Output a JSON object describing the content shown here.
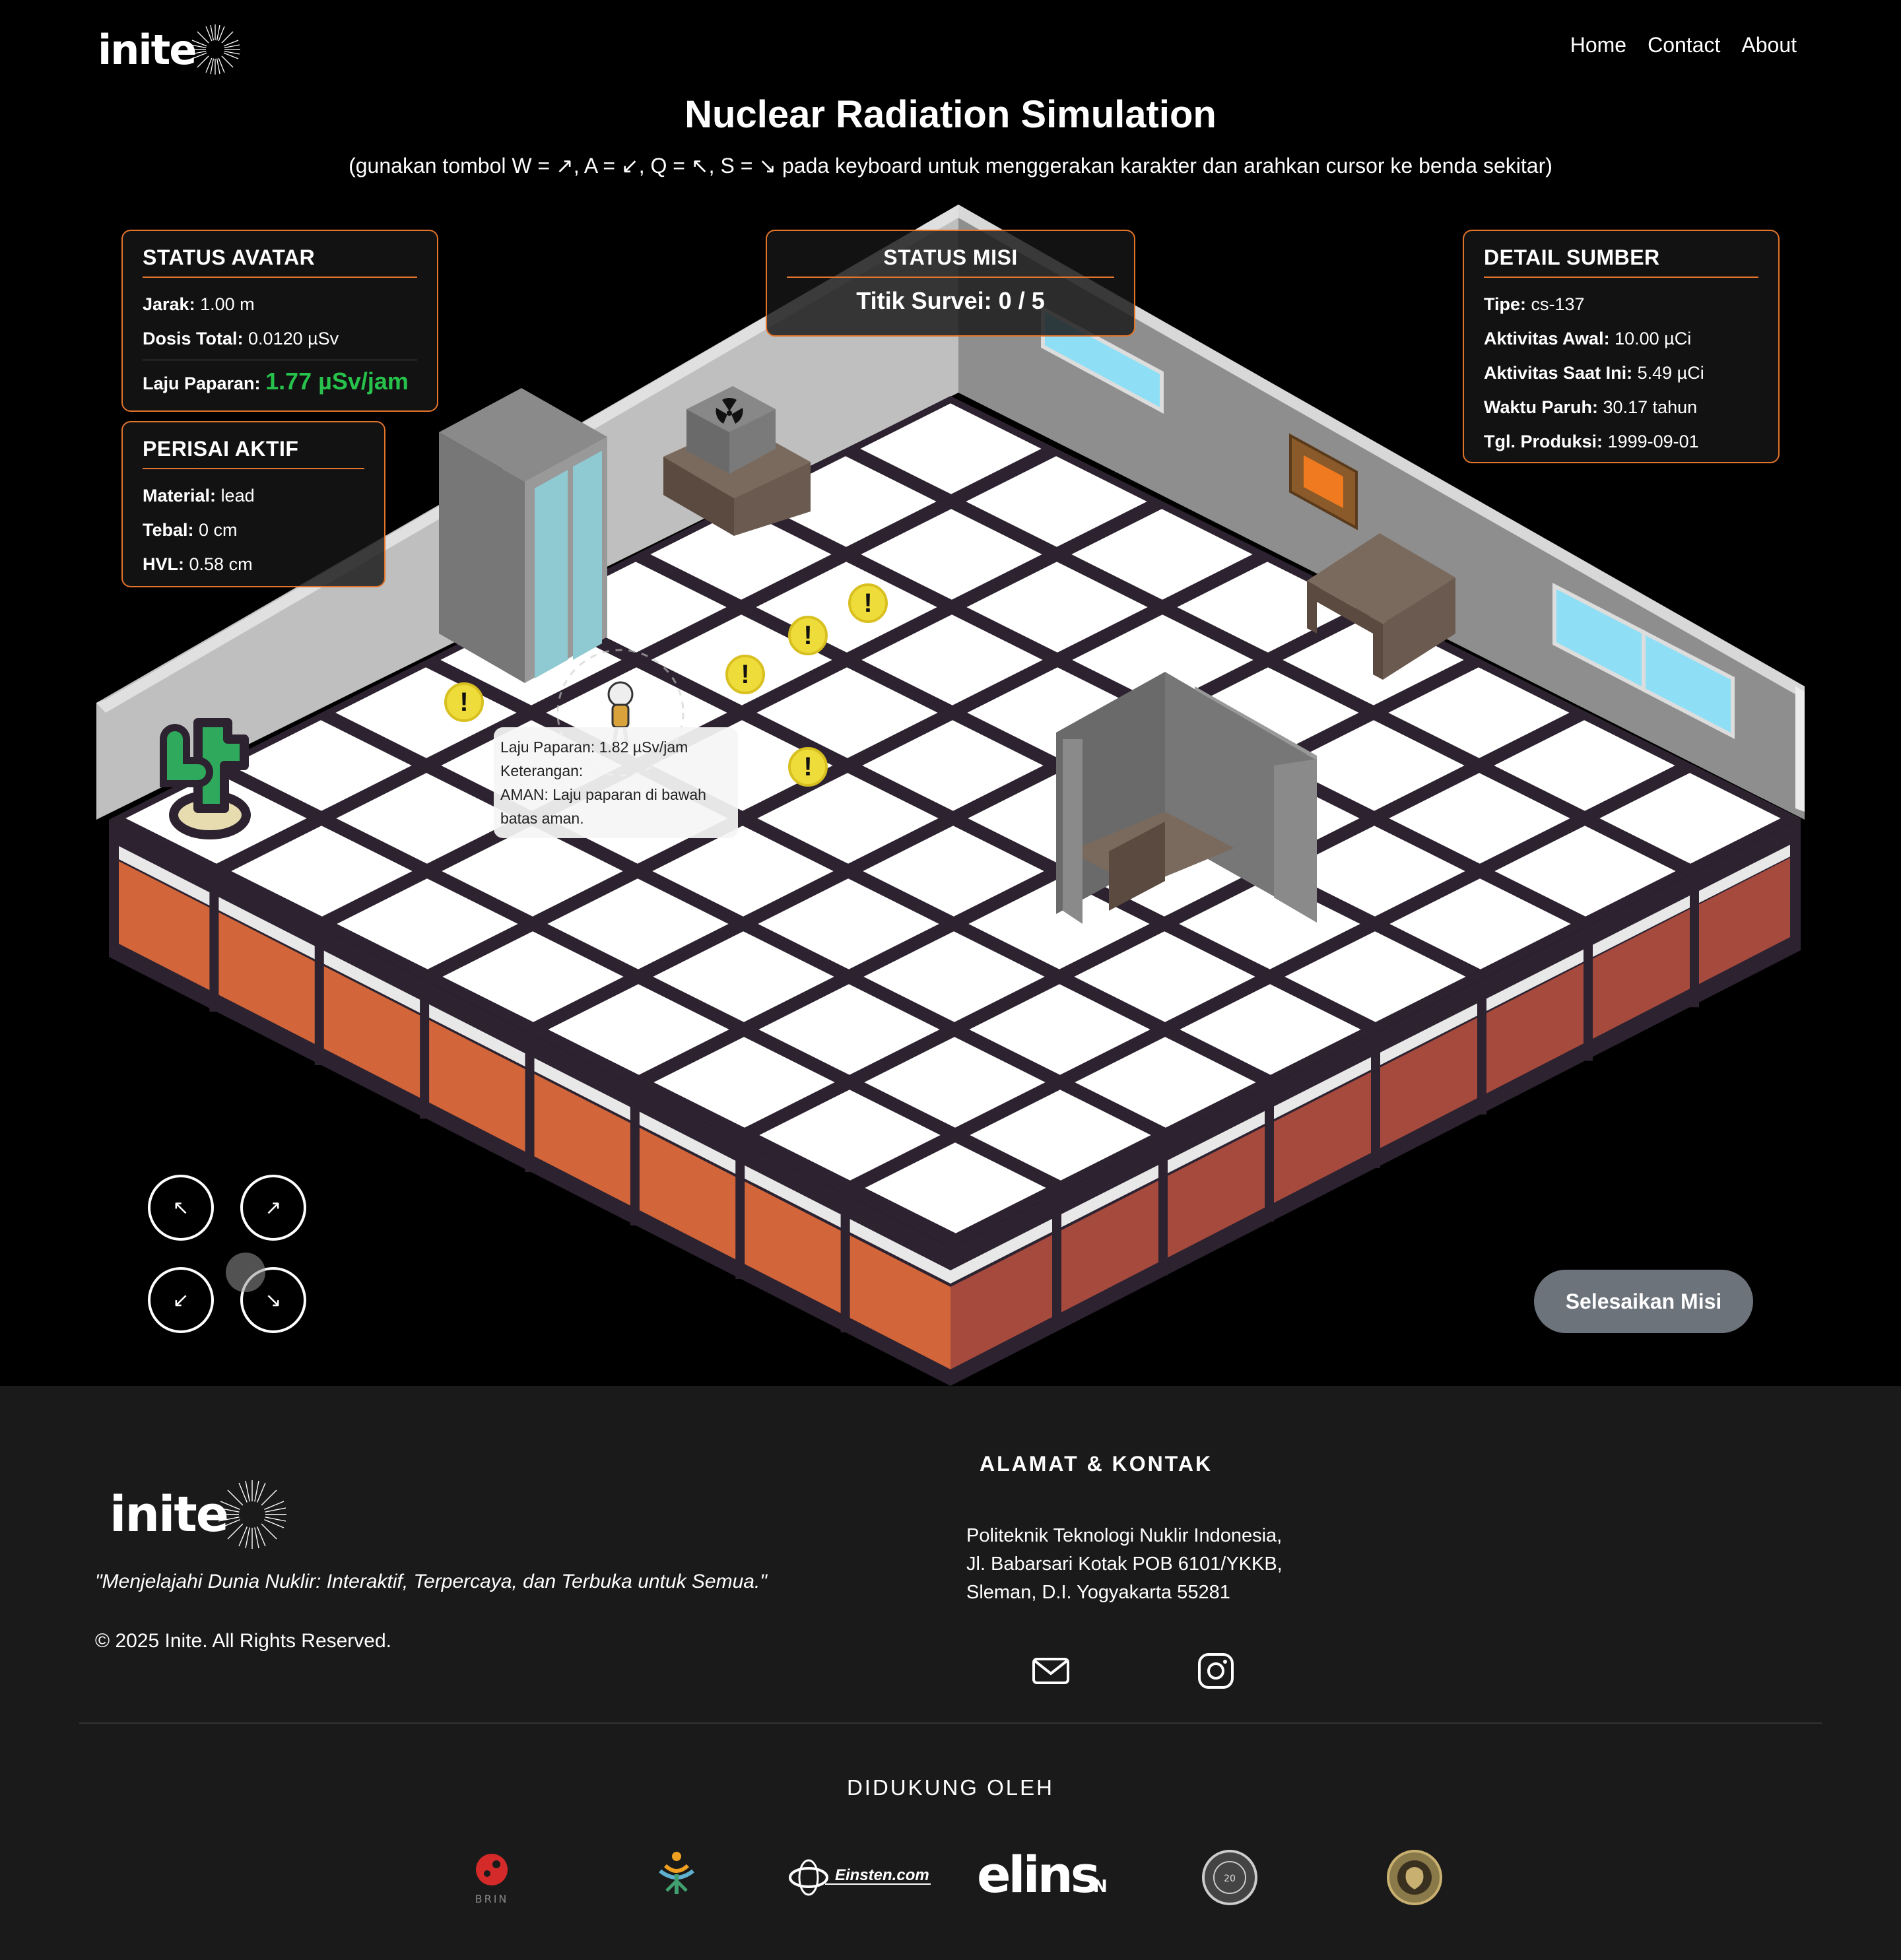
{
  "nav": {
    "logo": "inite",
    "links": [
      "Home",
      "Contact",
      "About"
    ]
  },
  "header": {
    "title": "Nuclear Radiation Simulation",
    "subtitle": "(gunakan tombol W = ↗, A = ↙, Q = ↖, S = ↘ pada keyboard untuk menggerakan karakter dan arahkan cursor ke benda sekitar)"
  },
  "avatar_status": {
    "heading": "STATUS AVATAR",
    "distance_label": "Jarak:",
    "distance_value": "1.00 m",
    "dose_label": "Dosis Total:",
    "dose_value": "0.0120 µSv",
    "rate_label": "Laju Paparan:",
    "rate_value": "1.77 µSv/jam"
  },
  "shield": {
    "heading": "PERISAI AKTIF",
    "material_label": "Material:",
    "material_value": "lead",
    "thickness_label": "Tebal:",
    "thickness_value": "0 cm",
    "hvl_label": "HVL:",
    "hvl_value": "0.58 cm"
  },
  "mission": {
    "heading": "STATUS MISI",
    "survey_label": "Titik Survei:",
    "survey_value": "0 / 5"
  },
  "source": {
    "heading": "DETAIL SUMBER",
    "type_label": "Tipe:",
    "type_value": "cs-137",
    "initial_label": "Aktivitas Awal:",
    "initial_value": "10.00 µCi",
    "current_label": "Aktivitas Saat Ini:",
    "current_value": "5.49 µCi",
    "halflife_label": "Waktu Paruh:",
    "halflife_value": "30.17 tahun",
    "production_label": "Tgl. Produksi:",
    "production_value": "1999-09-01"
  },
  "tooltip": {
    "line1": "Laju Paparan: 1.82 µSv/jam",
    "line2": "Keterangan:",
    "line3": "AMAN: Laju paparan di bawah",
    "line4": "batas aman."
  },
  "survey_marker": "!",
  "controls": {
    "up_left": "↖",
    "up_right": "↗",
    "down_left": "↙",
    "down_right": "↘",
    "finish": "Selesaikan Misi"
  },
  "footer": {
    "logo": "inite",
    "tagline": "\"Menjelajahi Dunia Nuklir: Interaktif, Terpercaya, dan Terbuka untuk Semua.\"",
    "copyright": "© 2025 Inite. All Rights Reserved.",
    "contact_heading": "ALAMAT & KONTAK",
    "address": [
      "Politeknik Teknologi Nuklir Indonesia,",
      "Jl. Babarsari Kotak POB 6101/YKKB,",
      "Sleman, D.I. Yogyakarta 55281"
    ],
    "support_heading": "DIDUKUNG OLEH",
    "sponsors": [
      "BRIN",
      "Poltek Nuklir",
      "Einsten.com",
      "elins",
      "Class of Instrumentation",
      "Emblem"
    ]
  },
  "colors": {
    "accent": "#e2742b",
    "safe_green": "#27c24c",
    "marker_yellow": "#eedc3a",
    "grid_dark": "#2d2230",
    "floor_orange": "#d2663a",
    "floor_red": "#a64a3e"
  }
}
